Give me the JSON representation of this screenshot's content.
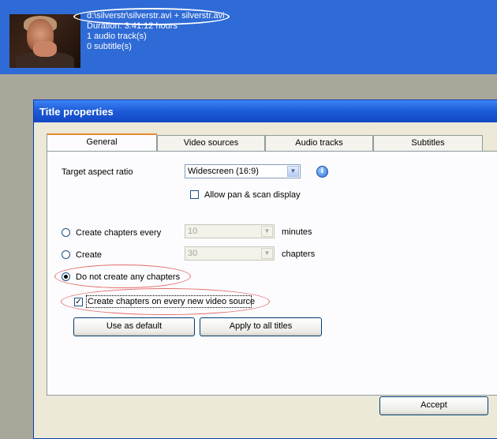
{
  "header": {
    "file_path": "d:\\silverstr\\silverstr.avi + silverstr.avi",
    "duration": "Duration: 3:41:12 hours",
    "audio_tracks": "1 audio track(s)",
    "subtitles": "0 subtitle(s)"
  },
  "dialog": {
    "title": "Title properties",
    "tabs": [
      "General",
      "Video sources",
      "Audio tracks",
      "Subtitles"
    ],
    "active_tab": "General",
    "aspect": {
      "label": "Target aspect ratio",
      "value": "Widescreen (16:9)",
      "pan_scan_label": "Allow pan & scan display",
      "pan_scan_checked": false
    },
    "chapters": {
      "every_label": "Create chapters every",
      "every_value": "10",
      "every_unit": "minutes",
      "create_label": "Create",
      "create_value": "30",
      "create_unit": "chapters",
      "none_label": "Do not create any chapters",
      "selected": "none",
      "on_new_source_label": "Create chapters on every new video source",
      "on_new_source_checked": true
    },
    "buttons": {
      "use_default": "Use as default",
      "apply_all": "Apply to all titles",
      "accept": "Accept"
    }
  },
  "colors": {
    "banner": "#2f6bd6",
    "titlebar": "#1c5ad6",
    "tab_highlight": "#e68b2c",
    "annotation_red": "#e46d6d"
  }
}
